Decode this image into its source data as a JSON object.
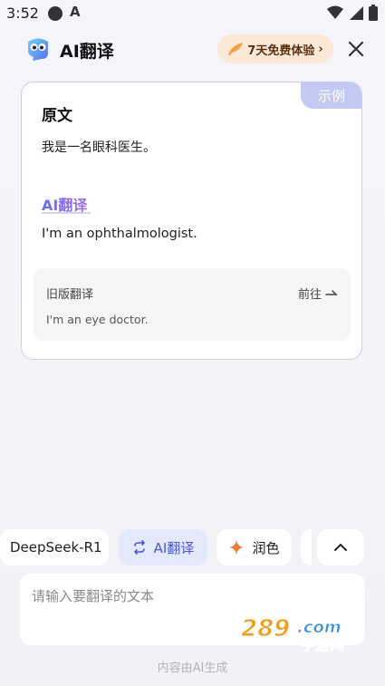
{
  "status_bar": {
    "time": "3:52"
  },
  "header": {
    "app_title": "AI翻译",
    "trial_label": "7天免费体验",
    "trial_chevron": "›"
  },
  "card": {
    "badge": "示例",
    "source_title": "原文",
    "source_text": "我是一名眼科医生。",
    "ai_title": "AI翻译",
    "ai_text": "I'm an ophthalmologist.",
    "old_title": "旧版翻译",
    "old_goto": "前往",
    "old_text": "I'm an eye doctor."
  },
  "chips": {
    "deepseek": "DeepSeek-R1",
    "ai_translate": "AI翻译",
    "polish": "润色"
  },
  "input": {
    "placeholder": "请输入要翻译的文本"
  },
  "footer": {
    "note": "内容由AI生成"
  },
  "watermark": {
    "text": "289.com 手游网"
  },
  "colors": {
    "accent": "#4a56d9",
    "badge": "#c2c9f2",
    "trial_bg": "#fbe8d6",
    "polish_star": "#f27a3a"
  },
  "icons": {
    "status": [
      "dot-icon",
      "a-icon",
      "wifi-icon",
      "signal-icon",
      "battery-icon"
    ],
    "header": [
      "owl-logo-icon",
      "feather-icon",
      "close-icon"
    ],
    "chips": [
      "swap-icon",
      "sparkle-icon",
      "chevron-up-icon"
    ],
    "card": [
      "arrow-right-icon"
    ]
  }
}
